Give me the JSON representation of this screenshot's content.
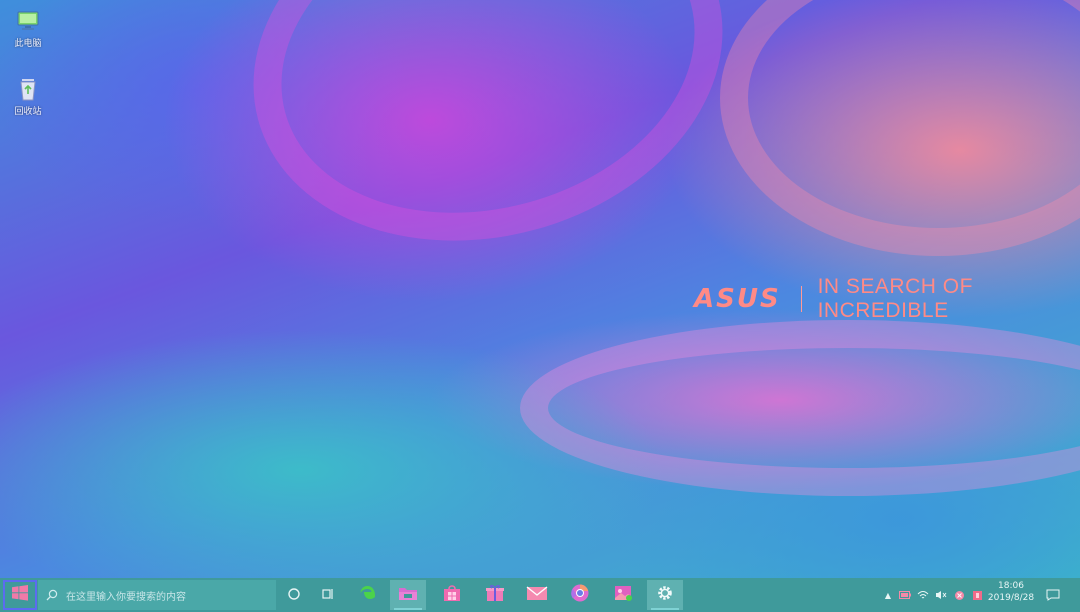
{
  "desktop": {
    "icons": [
      {
        "label": "此电脑",
        "icon": "computer-icon"
      },
      {
        "label": "回收站",
        "icon": "recycle-bin-icon"
      }
    ],
    "brand": {
      "logo": "ASUS",
      "tagline": "IN SEARCH OF INCREDIBLE"
    }
  },
  "taskbar": {
    "start_icon": "windows-logo-icon",
    "search": {
      "placeholder": "在这里输入你要搜索的内容",
      "icon": "search-icon"
    },
    "pinned": [
      {
        "name": "cortana",
        "icon": "circle-icon"
      },
      {
        "name": "task-view",
        "icon": "task-view-icon"
      },
      {
        "name": "edge",
        "icon": "edge-icon"
      },
      {
        "name": "file-explorer",
        "icon": "folder-icon"
      },
      {
        "name": "store",
        "icon": "store-bag-icon"
      },
      {
        "name": "gift",
        "icon": "gift-icon"
      },
      {
        "name": "mail",
        "icon": "mail-icon"
      },
      {
        "name": "chrome",
        "icon": "chrome-icon"
      },
      {
        "name": "photos-app",
        "icon": "photos-icon"
      },
      {
        "name": "settings",
        "icon": "gear-icon"
      }
    ],
    "tray": {
      "chevron": "▲",
      "icons": [
        "battery-icon",
        "wifi-icon",
        "volume-muted-icon",
        "app-tray-icon",
        "app-tray-icon-2"
      ],
      "time": "18:06",
      "date": "2019/8/28",
      "notification_icon": "notification-icon"
    }
  },
  "colors": {
    "taskbar": "#3f9a9b",
    "start_highlight": "#5b6cf0",
    "brand": "#ff8a86"
  }
}
